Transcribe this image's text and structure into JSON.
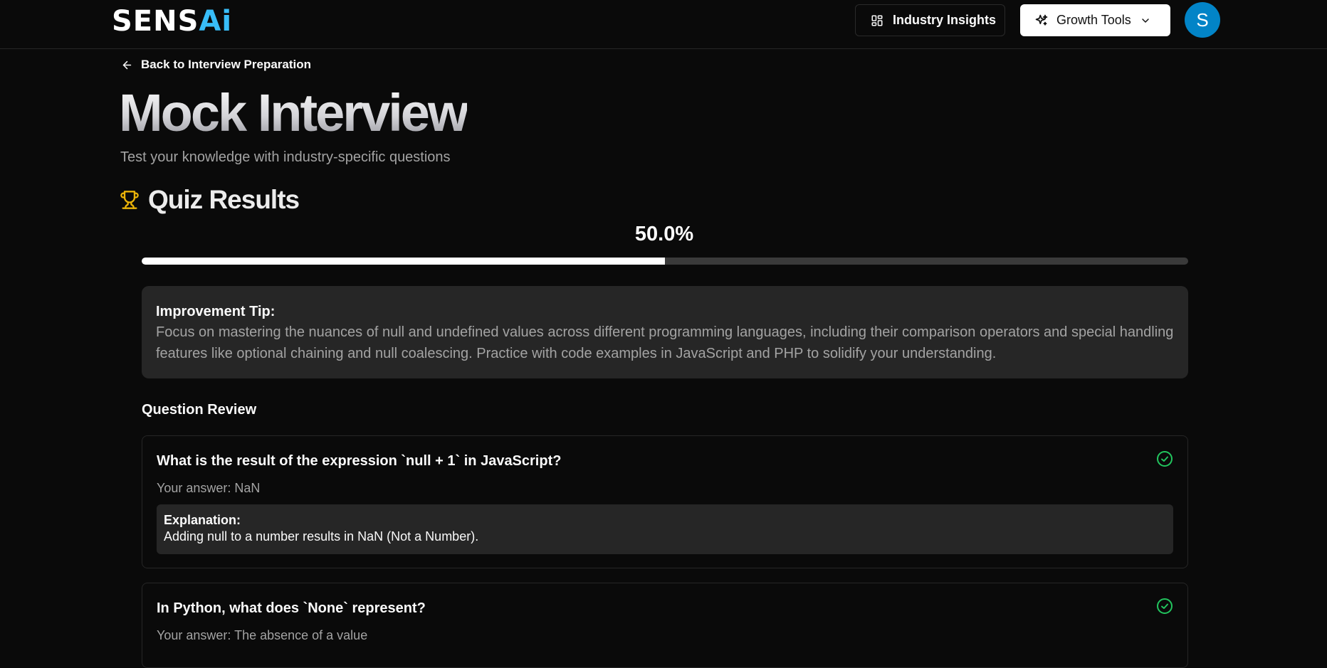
{
  "header": {
    "logo_part1": "SENS",
    "logo_part2": "Ai",
    "industry_insights_label": "Industry Insights",
    "growth_tools_label": "Growth Tools",
    "avatar_initial": "S",
    "icons": {
      "industry_insights": "layout-dashboard-icon",
      "growth_tools": "sparkles-icon",
      "growth_tools_chevron": "chevron-down-icon"
    },
    "colors": {
      "logo_accent": "#38bdf8",
      "avatar_bg": "#0284c7"
    }
  },
  "page": {
    "back_link": "Back to Interview Preparation",
    "title": "Mock Interview",
    "subtitle": "Test your knowledge with industry-specific questions"
  },
  "results": {
    "heading": "Quiz Results",
    "trophy_icon": "trophy-icon",
    "trophy_color": "#eab308",
    "score_text": "50.0%",
    "score_fraction": 0.5
  },
  "tip": {
    "title": "Improvement Tip:",
    "body": "Focus on mastering the nuances of null and undefined values across different programming languages, including their comparison operators and special handling features like optional chaining and null coalescing. Practice with code examples in JavaScript and PHP to solidify your understanding."
  },
  "review": {
    "heading": "Question Review",
    "check_color": "#22c55e",
    "questions": [
      {
        "question": "What is the result of the expression `null + 1` in JavaScript?",
        "answer": "Your answer: NaN",
        "explanation_label": "Explanation:",
        "explanation": "Adding null to a number results in NaN (Not a Number).",
        "status_icon": "check-circle-icon"
      },
      {
        "question": "In Python, what does `None` represent?",
        "answer": "Your answer: The absence of a value",
        "status_icon": "check-circle-icon"
      }
    ]
  }
}
